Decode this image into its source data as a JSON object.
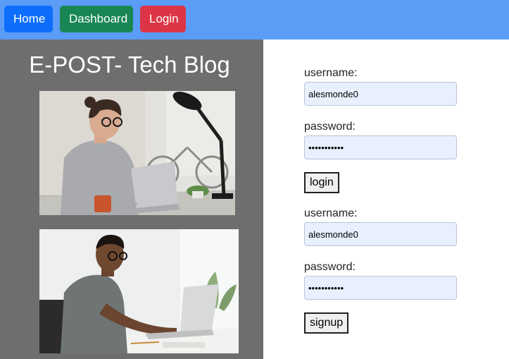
{
  "nav": {
    "home_label": "Home",
    "dashboard_label": "Dashboard",
    "login_label": "Login",
    "bar_color": "#5b9cf6",
    "home_color": "#0d6efd",
    "dashboard_color": "#198754",
    "login_color": "#dc3545"
  },
  "blog": {
    "title": "E-POST- Tech Blog",
    "panel_color": "#6e6e6e",
    "images": [
      {
        "name": "woman-laptop-photo"
      },
      {
        "name": "man-laptop-photo"
      }
    ]
  },
  "login_form": {
    "username_label": "username:",
    "username_value": "alesmonde0",
    "password_label": "password:",
    "password_value": "•••••••••••",
    "submit_label": "login"
  },
  "signup_form": {
    "username_label": "username:",
    "username_value": "alesmonde0",
    "password_label": "password:",
    "password_value": "•••••••••••",
    "submit_label": "signup"
  }
}
